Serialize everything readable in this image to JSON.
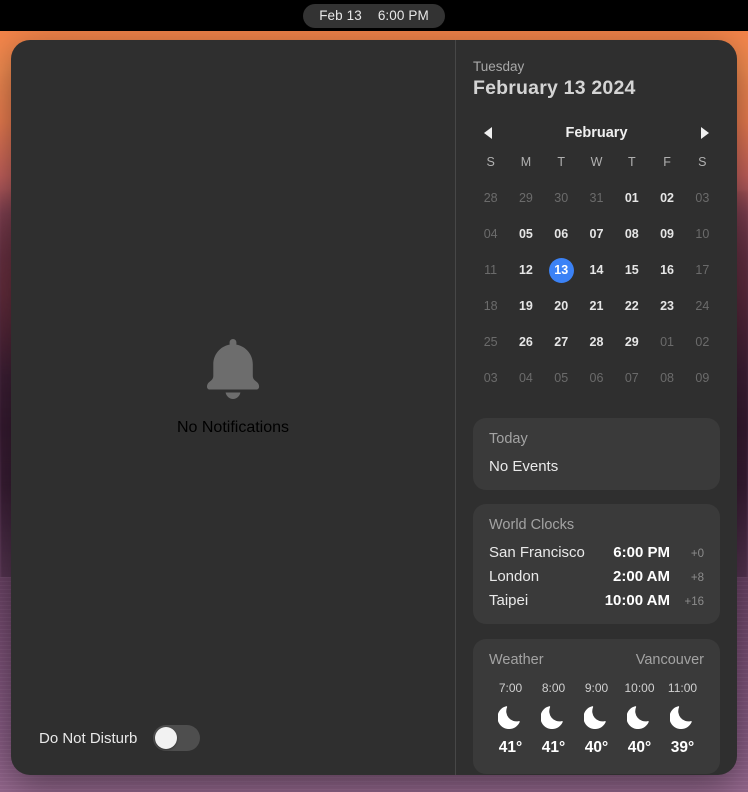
{
  "menubar": {
    "date": "Feb 13",
    "time": "6:00 PM"
  },
  "notifications": {
    "empty_text": "No Notifications",
    "bell_icon": "bell-icon",
    "do_not_disturb_label": "Do Not Disturb",
    "do_not_disturb_state": "off"
  },
  "header": {
    "weekday": "Tuesday",
    "full_date": "February 13 2024"
  },
  "calendar": {
    "month": "February",
    "prev_icon": "chevron-left-icon",
    "next_icon": "chevron-right-icon",
    "day_headers": [
      "S",
      "M",
      "T",
      "W",
      "T",
      "F",
      "S"
    ],
    "selected_day": "13",
    "accent_color": "#3b82f6",
    "weeks": [
      [
        {
          "d": "28",
          "dim": true
        },
        {
          "d": "29",
          "dim": true
        },
        {
          "d": "30",
          "dim": true
        },
        {
          "d": "31",
          "dim": true
        },
        {
          "d": "01",
          "dim": false
        },
        {
          "d": "02",
          "dim": false
        },
        {
          "d": "03",
          "dim": true
        }
      ],
      [
        {
          "d": "04",
          "dim": true
        },
        {
          "d": "05",
          "dim": false
        },
        {
          "d": "06",
          "dim": false
        },
        {
          "d": "07",
          "dim": false
        },
        {
          "d": "08",
          "dim": false
        },
        {
          "d": "09",
          "dim": false
        },
        {
          "d": "10",
          "dim": true
        }
      ],
      [
        {
          "d": "11",
          "dim": true
        },
        {
          "d": "12",
          "dim": false
        },
        {
          "d": "13",
          "dim": false,
          "today": true
        },
        {
          "d": "14",
          "dim": false
        },
        {
          "d": "15",
          "dim": false
        },
        {
          "d": "16",
          "dim": false
        },
        {
          "d": "17",
          "dim": true
        }
      ],
      [
        {
          "d": "18",
          "dim": true
        },
        {
          "d": "19",
          "dim": false
        },
        {
          "d": "20",
          "dim": false
        },
        {
          "d": "21",
          "dim": false
        },
        {
          "d": "22",
          "dim": false
        },
        {
          "d": "23",
          "dim": false
        },
        {
          "d": "24",
          "dim": true
        }
      ],
      [
        {
          "d": "25",
          "dim": true
        },
        {
          "d": "26",
          "dim": false
        },
        {
          "d": "27",
          "dim": false
        },
        {
          "d": "28",
          "dim": false
        },
        {
          "d": "29",
          "dim": false
        },
        {
          "d": "01",
          "dim": true
        },
        {
          "d": "02",
          "dim": true
        }
      ],
      [
        {
          "d": "03",
          "dim": true
        },
        {
          "d": "04",
          "dim": true
        },
        {
          "d": "05",
          "dim": true
        },
        {
          "d": "06",
          "dim": true
        },
        {
          "d": "07",
          "dim": true
        },
        {
          "d": "08",
          "dim": true
        },
        {
          "d": "09",
          "dim": true
        }
      ]
    ]
  },
  "events": {
    "title": "Today",
    "body": "No Events"
  },
  "world_clocks": {
    "title": "World Clocks",
    "rows": [
      {
        "city": "San Francisco",
        "time": "6:00 PM",
        "offset": "+0"
      },
      {
        "city": "London",
        "time": "2:00 AM",
        "offset": "+8"
      },
      {
        "city": "Taipei",
        "time": "10:00 AM",
        "offset": "+16"
      }
    ]
  },
  "weather": {
    "title": "Weather",
    "location": "Vancouver",
    "hours": [
      {
        "time": "7:00",
        "icon": "crescent-moon-icon",
        "temp": "41°"
      },
      {
        "time": "8:00",
        "icon": "crescent-moon-icon",
        "temp": "41°"
      },
      {
        "time": "9:00",
        "icon": "crescent-moon-icon",
        "temp": "40°"
      },
      {
        "time": "10:00",
        "icon": "crescent-moon-icon",
        "temp": "40°"
      },
      {
        "time": "11:00",
        "icon": "crescent-moon-icon",
        "temp": "39°"
      }
    ]
  }
}
